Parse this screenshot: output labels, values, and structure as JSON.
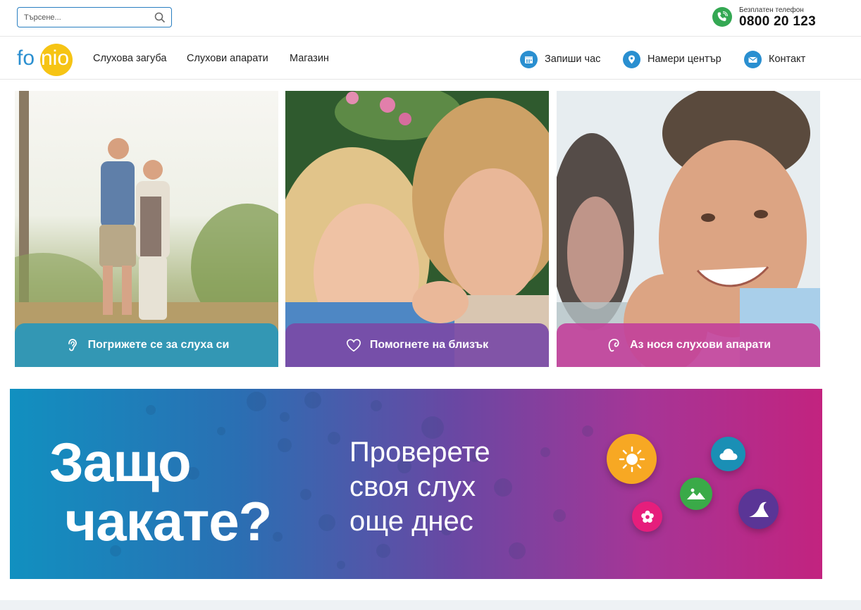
{
  "search": {
    "placeholder": "Търсене..."
  },
  "phone": {
    "label": "Безплатен телефон",
    "number": "0800 20 123"
  },
  "logo": {
    "text": "fonio"
  },
  "nav": {
    "left": [
      {
        "label": "Слухова загуба"
      },
      {
        "label": "Слухови апарати"
      },
      {
        "label": "Магазин"
      }
    ],
    "right": [
      {
        "label": "Запиши час",
        "icon": "calendar-icon"
      },
      {
        "label": "Намери център",
        "icon": "location-pin-icon"
      },
      {
        "label": "Контакт",
        "icon": "envelope-icon"
      }
    ]
  },
  "cards": [
    {
      "label": "Погрижете се за слуха си",
      "icon": "ear-icon",
      "color": "#2b9bc0"
    },
    {
      "label": "Помогнете на близък",
      "icon": "heart-icon",
      "color": "#7a4aa6"
    },
    {
      "label": "Аз нося слухови апарати",
      "icon": "hearing-aid-icon",
      "color": "#c0409a"
    }
  ],
  "banner": {
    "headline_line1": "Защо",
    "headline_line2": "чакате?",
    "sub_line1": "Проверете",
    "sub_line2": "своя слух",
    "sub_line3": "още днес",
    "bubbles": [
      {
        "icon": "sun-icon",
        "color": "#f7a823"
      },
      {
        "icon": "cloud-icon",
        "color": "#1a8fb5"
      },
      {
        "icon": "mountain-icon",
        "color": "#3aaa48"
      },
      {
        "icon": "flower-icon",
        "color": "#e61e7c"
      },
      {
        "icon": "moon-wave-icon",
        "color": "#5a3596"
      }
    ]
  },
  "colors": {
    "accent_blue": "#2a8fd0",
    "phone_green": "#34a853",
    "logo_yellow": "#f6c414"
  }
}
